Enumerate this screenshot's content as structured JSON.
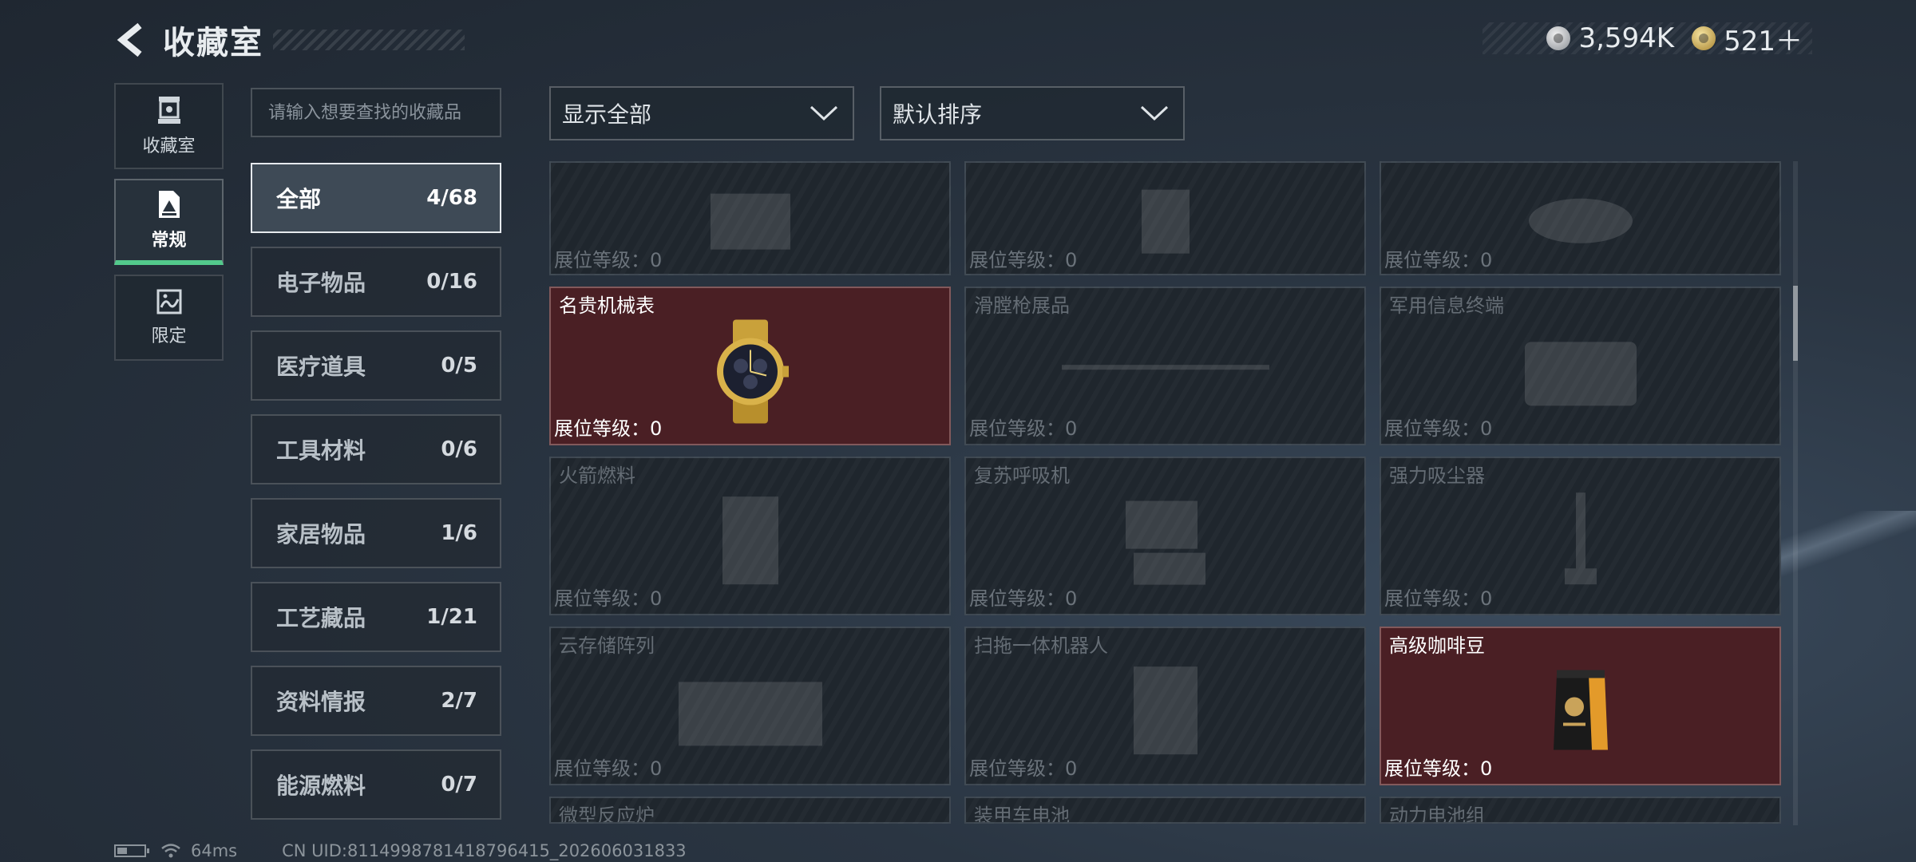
{
  "header": {
    "title": "收藏室"
  },
  "currency": {
    "silver": "3,594K",
    "gold": "521＋"
  },
  "rail": [
    {
      "label": "收藏室",
      "icon": "trophy-icon"
    },
    {
      "label": "常规",
      "icon": "collection-icon"
    },
    {
      "label": "限定",
      "icon": "limited-icon"
    }
  ],
  "search": {
    "placeholder": "请输入想要查找的收藏品"
  },
  "categories": [
    {
      "name": "全部",
      "count": "4/68"
    },
    {
      "name": "电子物品",
      "count": "0/16"
    },
    {
      "name": "医疗道具",
      "count": "0/5"
    },
    {
      "name": "工具材料",
      "count": "0/6"
    },
    {
      "name": "家居物品",
      "count": "1/6"
    },
    {
      "name": "工艺藏品",
      "count": "1/21"
    },
    {
      "name": "资料情报",
      "count": "2/7"
    },
    {
      "name": "能源燃料",
      "count": "0/7"
    }
  ],
  "filters": {
    "show": "显示全部",
    "sort": "默认排序"
  },
  "tiles": [
    {
      "name": "",
      "level": "展位等级：0",
      "owned": false
    },
    {
      "name": "",
      "level": "展位等级：0",
      "owned": false
    },
    {
      "name": "",
      "level": "展位等级：0",
      "owned": false
    },
    {
      "name": "名贵机械表",
      "level": "展位等级：0",
      "owned": true
    },
    {
      "name": "滑膛枪展品",
      "level": "展位等级：0",
      "owned": false
    },
    {
      "name": "军用信息终端",
      "level": "展位等级：0",
      "owned": false
    },
    {
      "name": "火箭燃料",
      "level": "展位等级：0",
      "owned": false
    },
    {
      "name": "复苏呼吸机",
      "level": "展位等级：0",
      "owned": false
    },
    {
      "name": "强力吸尘器",
      "level": "展位等级：0",
      "owned": false
    },
    {
      "name": "云存储阵列",
      "level": "展位等级：0",
      "owned": false
    },
    {
      "name": "扫拖一体机器人",
      "level": "展位等级：0",
      "owned": false
    },
    {
      "name": "高级咖啡豆",
      "level": "展位等级：0",
      "owned": true
    },
    {
      "name": "微型反应炉",
      "level": "",
      "owned": false
    },
    {
      "name": "装甲车电池",
      "level": "",
      "owned": false
    },
    {
      "name": "动力电池组",
      "level": "",
      "owned": false
    }
  ],
  "footer": {
    "ping": "64ms",
    "uid": "CN UID:8114998781418796415_202606031833"
  },
  "colors": {
    "accent": "#53c98c",
    "owned_bg": "#4a1f24"
  }
}
